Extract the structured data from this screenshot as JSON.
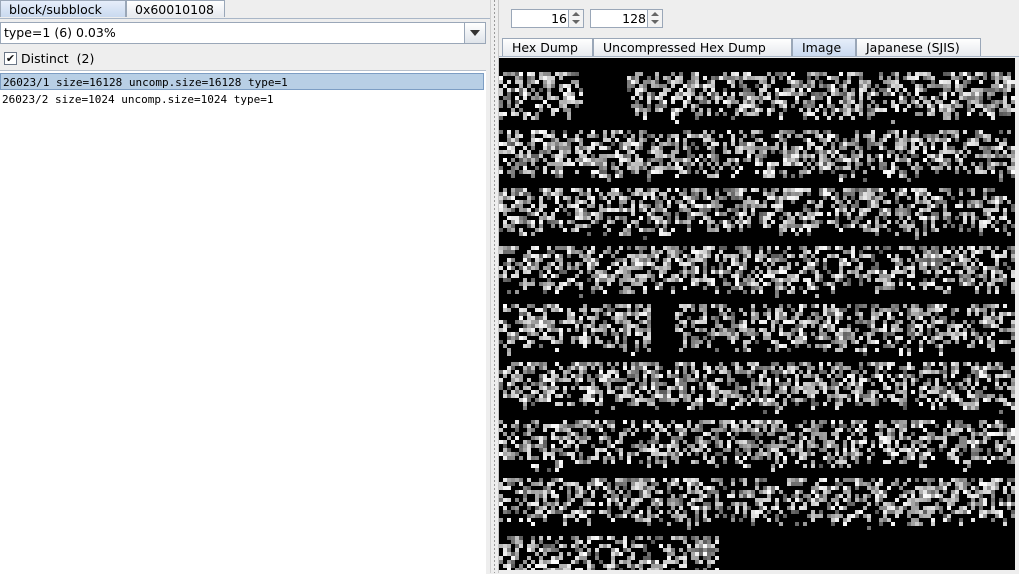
{
  "left": {
    "tabs": [
      {
        "label": "block/subblock",
        "selected": true
      },
      {
        "label": "0x60010108",
        "selected": false
      }
    ],
    "filter_combo": {
      "value": "type=1 (6) 0.03%"
    },
    "distinct": {
      "checked": true,
      "label": "Distinct  (2)"
    },
    "items": [
      {
        "text": "26023/1 size=16128 uncomp.size=16128 type=1",
        "selected": true
      },
      {
        "text": "26023/2 size=1024 uncomp.size=1024 type=1",
        "selected": false
      }
    ]
  },
  "right": {
    "spinner_a": {
      "value": "16"
    },
    "spinner_b": {
      "value": "128"
    },
    "tabs": [
      {
        "label": "Hex Dump",
        "selected": false
      },
      {
        "label": "Uncompressed Hex Dump",
        "selected": false
      },
      {
        "label": "Image",
        "selected": true
      },
      {
        "label": "Japanese (SJIS)",
        "selected": false
      }
    ],
    "image_view": {
      "background": "#000000",
      "content": "grayscale glyph bitmap"
    }
  }
}
